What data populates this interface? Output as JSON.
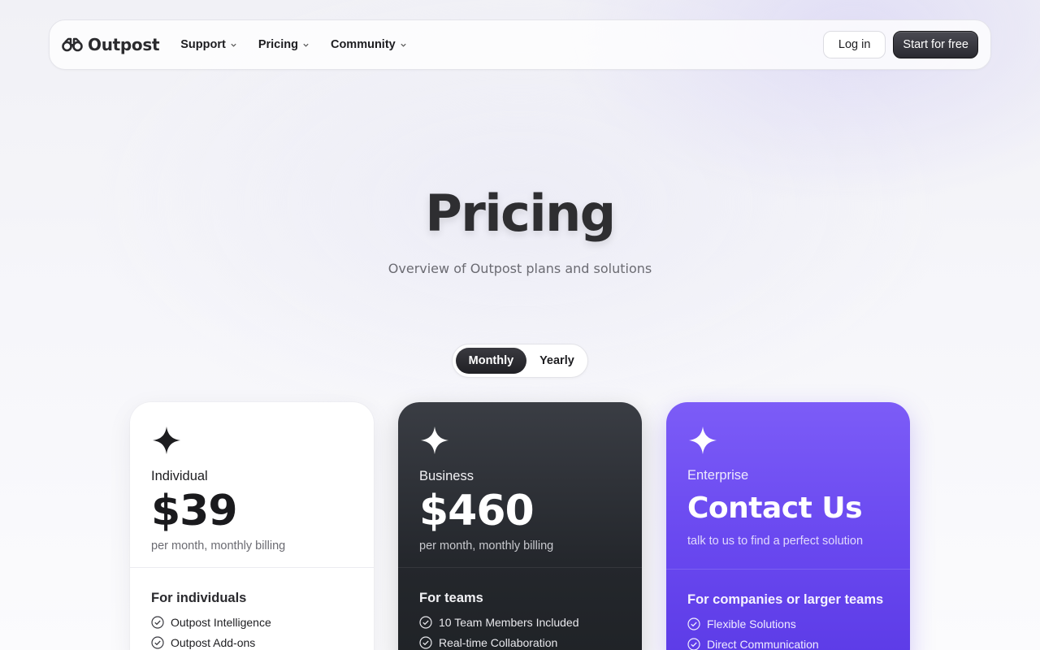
{
  "brand": {
    "name": "Outpost",
    "logo_icon": "binoculars-icon"
  },
  "nav": {
    "items": [
      {
        "label": "Support",
        "icon": "chevron-down-icon"
      },
      {
        "label": "Pricing",
        "icon": "chevron-down-icon"
      },
      {
        "label": "Community",
        "icon": "chevron-down-icon"
      }
    ],
    "login_label": "Log in",
    "start_label": "Start for free"
  },
  "hero": {
    "title": "Pricing",
    "subtitle": "Overview of Outpost plans and solutions"
  },
  "billing_toggle": {
    "options": [
      "Monthly",
      "Yearly"
    ],
    "selected": "Monthly"
  },
  "plans": [
    {
      "name": "Individual",
      "price": "$39",
      "price_note": "per month, monthly billing",
      "section_title": "For individuals",
      "features": [
        "Outpost Intelligence",
        "Outpost Add-ons"
      ],
      "icon": "sparkle-icon",
      "theme_color": "#ffffff"
    },
    {
      "name": "Business",
      "price": "$460",
      "price_note": "per month, monthly billing",
      "section_title": "For teams",
      "features": [
        "10 Team Members Included",
        "Real-time Collaboration"
      ],
      "icon": "sparkle-icon",
      "theme_color": "#2a2d33"
    },
    {
      "name": "Enterprise",
      "price": "Contact Us",
      "price_note": "talk to us to find a perfect solution",
      "section_title": "For companies or larger teams",
      "features": [
        "Flexible Solutions",
        "Direct Communication"
      ],
      "icon": "sparkle-icon",
      "theme_color": "#6a49f0"
    }
  ]
}
